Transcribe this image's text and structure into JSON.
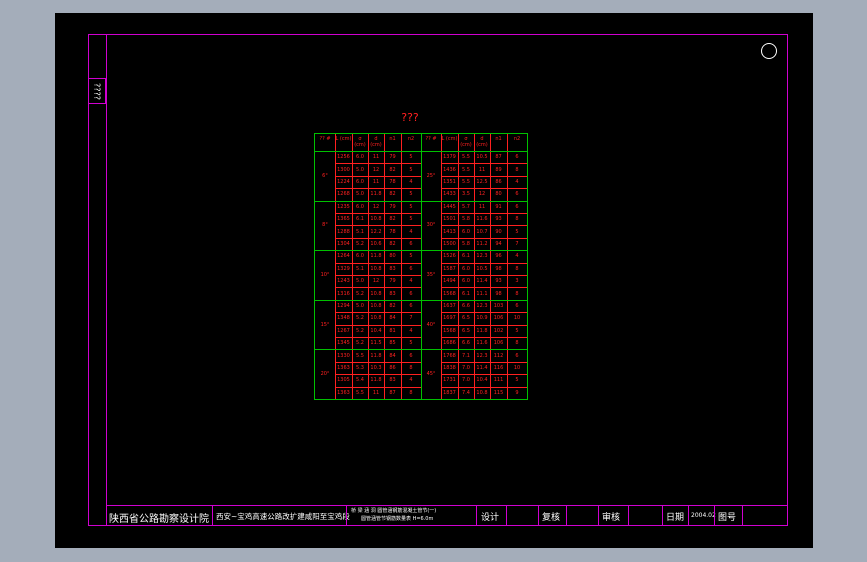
{
  "side_tab": "????",
  "table": {
    "title": "???",
    "header": [
      "?? #",
      "L (cm)",
      "σ (cm)",
      "d (cm)",
      "n1",
      "n2",
      "?? #",
      "L (cm)",
      "σ (cm)",
      "d (cm)",
      "n1",
      "n2"
    ],
    "left_groups": [
      "6°",
      "8°",
      "10°",
      "15°",
      "20°"
    ],
    "right_groups": [
      "25°",
      "30°",
      "35°",
      "40°",
      "45°"
    ],
    "rows": [
      [
        "1256",
        "6.0",
        "11",
        "79",
        "5",
        "1379",
        "5.5",
        "10.5",
        "87",
        "6"
      ],
      [
        "1300",
        "5.0",
        "12",
        "82",
        "5",
        "1436",
        "5.5",
        "11",
        "89",
        "8"
      ],
      [
        "1224",
        "6.0",
        "11",
        "78",
        "4",
        "1351",
        "5.5",
        "12.5",
        "86",
        "4"
      ],
      [
        "1268",
        "5.0",
        "11.8",
        "82",
        "5",
        "1433",
        "3.5",
        "12",
        "80",
        "6"
      ],
      [
        "1235",
        "6.0",
        "12",
        "79",
        "5",
        "1445",
        "5.7",
        "11",
        "91",
        "6"
      ],
      [
        "1365",
        "6.1",
        "10.8",
        "82",
        "5",
        "1501",
        "5.8",
        "11.6",
        "93",
        "8"
      ],
      [
        "1288",
        "5.1",
        "12.2",
        "78",
        "4",
        "1413",
        "6.0",
        "10.7",
        "90",
        "5"
      ],
      [
        "1304",
        "5.2",
        "10.6",
        "82",
        "6",
        "1500",
        "5.8",
        "11.2",
        "94",
        "7"
      ],
      [
        "1264",
        "6.0",
        "11.8",
        "80",
        "5",
        "1526",
        "6.1",
        "12.3",
        "96",
        "4"
      ],
      [
        "1329",
        "5.1",
        "10.8",
        "83",
        "6",
        "1587",
        "6.0",
        "10.5",
        "98",
        "8"
      ],
      [
        "1243",
        "5.0",
        "12",
        "79",
        "4",
        "1494",
        "6.0",
        "11.4",
        "93",
        "3"
      ],
      [
        "1316",
        "5.2",
        "10.8",
        "83",
        "6",
        "1568",
        "6.1",
        "11.1",
        "98",
        "8"
      ],
      [
        "1294",
        "5.0",
        "10.8",
        "82",
        "6",
        "1637",
        "6.6",
        "12.3",
        "103",
        "6"
      ],
      [
        "1348",
        "5.2",
        "10.8",
        "84",
        "7",
        "1697",
        "6.5",
        "10.9",
        "106",
        "10"
      ],
      [
        "1267",
        "5.2",
        "10.4",
        "81",
        "4",
        "1568",
        "6.5",
        "11.8",
        "102",
        "5"
      ],
      [
        "1345",
        "5.2",
        "11.5",
        "85",
        "5",
        "1686",
        "6.6",
        "11.6",
        "106",
        "8"
      ],
      [
        "1330",
        "5.5",
        "11.8",
        "84",
        "6",
        "1768",
        "7.1",
        "12.3",
        "112",
        "6"
      ],
      [
        "1363",
        "5.3",
        "10.3",
        "86",
        "8",
        "1838",
        "7.0",
        "11.4",
        "116",
        "10"
      ],
      [
        "1305",
        "5.4",
        "11.8",
        "83",
        "4",
        "1731",
        "7.0",
        "10.4",
        "111",
        "5"
      ],
      [
        "1363",
        "5.5",
        "11",
        "87",
        "8",
        "1837",
        "7.4",
        "10.8",
        "115",
        "9"
      ]
    ]
  },
  "title_block": {
    "institute": "陕西省公路勘察设计院",
    "project": "西安~宝鸡高速公路改扩建咸阳至宝鸡段",
    "drawing_line1": "桥 梁 涵 洞 圆管涵钢筋混凝土管节(一)",
    "drawing_line2": "圆管涵管节钢筋数量表 H=6.0m",
    "design_label": "设计",
    "review_label": "复核",
    "approve_label": "审核",
    "date_label": "日期",
    "date_value": "2004.02",
    "drawing_no_label": "图号"
  },
  "colors": {
    "border": "#d000d0",
    "grid": "#00c000",
    "text_red": "#ff2020",
    "text_white": "#ffffff"
  }
}
